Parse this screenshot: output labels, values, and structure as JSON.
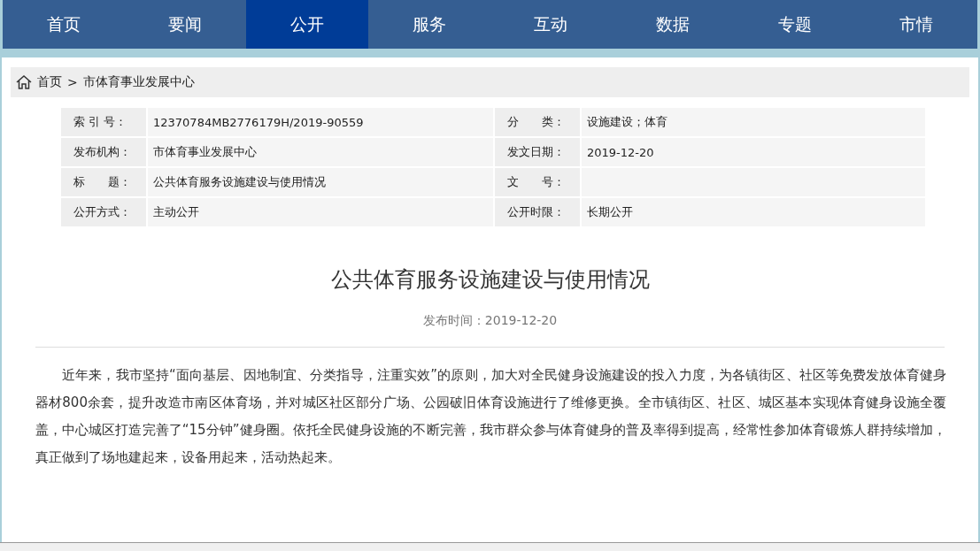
{
  "nav": [
    {
      "label": "首页",
      "selected": false
    },
    {
      "label": "要闻",
      "selected": false
    },
    {
      "label": "公开",
      "selected": true
    },
    {
      "label": "服务",
      "selected": false
    },
    {
      "label": "互动",
      "selected": false
    },
    {
      "label": "数据",
      "selected": false
    },
    {
      "label": "专题",
      "selected": false
    },
    {
      "label": "市情",
      "selected": false
    }
  ],
  "breadcrumb": {
    "home": "首页",
    "separator": ">",
    "current": "市体育事业发展中心"
  },
  "meta_table": {
    "rows": [
      {
        "label_1": "索 引 号：",
        "value_1": "12370784MB2776179H/2019-90559",
        "label_2": "分　　类：",
        "value_2": "设施建设；体育"
      },
      {
        "label_1": "发布机构：",
        "value_1": "市体育事业发展中心",
        "label_2": "发文日期：",
        "value_2": "2019-12-20"
      },
      {
        "label_1": "标　　题：",
        "value_1": "公共体育服务设施建设与使用情况",
        "label_2": "文　　号：",
        "value_2": ""
      },
      {
        "label_1": "公开方式：",
        "value_1": "主动公开",
        "label_2": "公开时限：",
        "value_2": "长期公开"
      }
    ]
  },
  "article": {
    "title": "公共体育服务设施建设与使用情况",
    "date": "发布时间：2019-12-20",
    "body": "近年来，我市坚持“面向基层、因地制宜、分类指导，注重实效”的原则，加大对全民健身设施建设的投入力度，为各镇街区、社区等免费发放体育健身器材800余套，提升改造市南区体育场，并对城区社区部分广场、公园破旧体育设施进行了维修更换。全市镇街区、社区、城区基本实现体育健身设施全覆盖，中心城区打造完善了“15分钟”健身圈。依托全民健身设施的不断完善，我市群众参与体育健身的普及率得到提高，经常性参加体育锻炼人群持续增加，真正做到了场地建起来，设备用起来，活动热起来。"
  }
}
